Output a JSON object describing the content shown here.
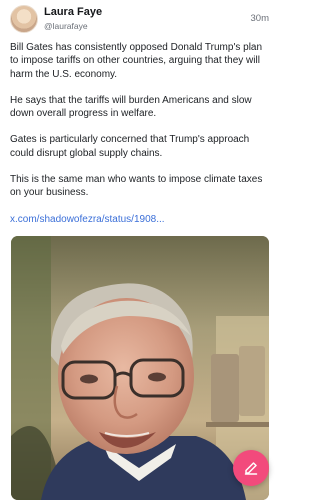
{
  "post": {
    "author_name": "Laura Faye",
    "author_handle": "@laurafaye",
    "timestamp": "30m",
    "paragraphs": [
      "Bill Gates has consistently opposed Donald Trump's plan to impose tariffs on other countries, arguing that they will harm the U.S. economy.",
      "He says that the tariffs will burden Americans and slow down overall progress in welfare.",
      "Gates is particularly concerned that Trump's approach could disrupt global supply chains.",
      "This is the same man who wants to impose climate taxes on your business."
    ],
    "link_text": "x.com/shadowofezra/status/1908...",
    "media_icon": "video-thumbnail"
  },
  "compose_button": {
    "icon": "edit-icon"
  },
  "colors": {
    "accent": "#f24a7c",
    "link": "#3b6fd8"
  }
}
